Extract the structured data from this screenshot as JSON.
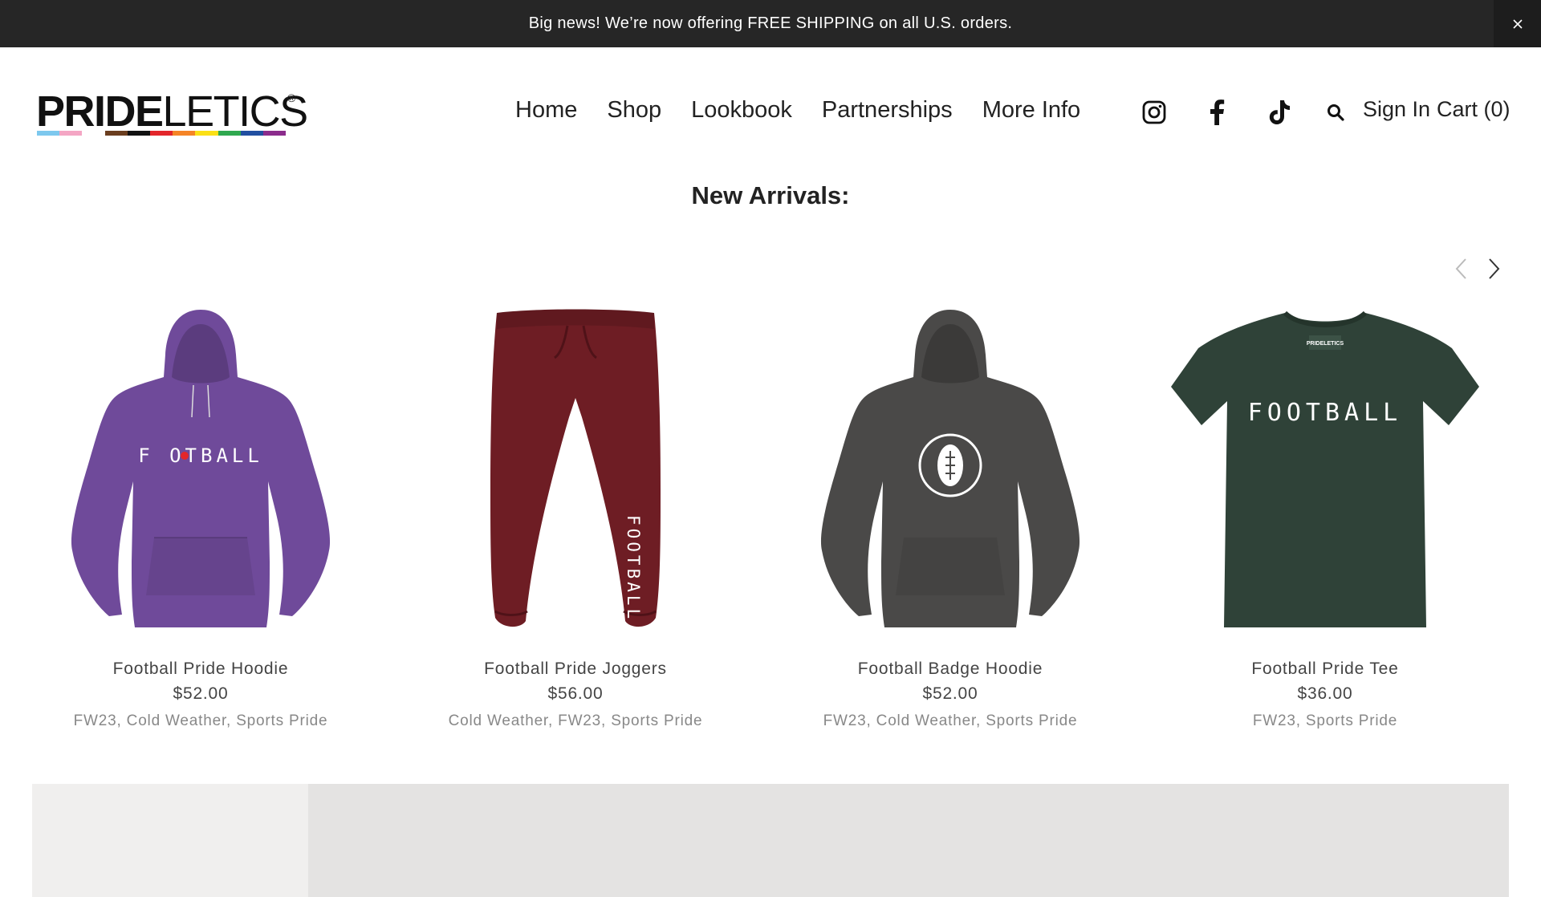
{
  "announcement": {
    "text": "Big news! We’re now offering FREE SHIPPING on all U.S. orders.",
    "close_icon": "close-icon"
  },
  "brand": {
    "logo_bold": "PRIDE",
    "logo_light": "LETICS",
    "registered": "®",
    "stripe_colors": [
      "#7dc8ee",
      "#f4a6c4",
      "#ffffff",
      "#6b3e1f",
      "#111111",
      "#e3262b",
      "#f58426",
      "#fbe016",
      "#2fa84f",
      "#214fa1",
      "#8b2c8c"
    ]
  },
  "nav": {
    "items": [
      "Home",
      "Shop",
      "Lookbook",
      "Partnerships",
      "More Info"
    ]
  },
  "header_icons": {
    "instagram": "instagram-icon",
    "facebook": "facebook-icon",
    "tiktok": "tiktok-icon",
    "search": "search-icon"
  },
  "account": {
    "sign_in": "Sign In",
    "cart": "Cart (0)"
  },
  "section": {
    "title": "New Arrivals:"
  },
  "carousel": {
    "prev_icon": "chevron-left-icon",
    "next_icon": "chevron-right-icon"
  },
  "products": [
    {
      "name": "Football Pride Hoodie",
      "price": "$52.00",
      "tags": "FW23, Cold Weather, Sports Pride",
      "color": "#6f4a9a",
      "print": "F🏈OTBALL"
    },
    {
      "name": "Football Pride Joggers",
      "price": "$56.00",
      "tags": "Cold Weather, FW23, Sports Pride",
      "color": "#6e1d24",
      "print": "FOOTBALL"
    },
    {
      "name": "Football Badge Hoodie",
      "price": "$52.00",
      "tags": "FW23, Cold Weather, Sports Pride",
      "color": "#4a4948"
    },
    {
      "name": "Football Pride Tee",
      "price": "$36.00",
      "tags": "FW23, Sports Pride",
      "color": "#2f4238",
      "print": "FOOTBALL",
      "label_brand": "PRIDELETICS"
    }
  ]
}
